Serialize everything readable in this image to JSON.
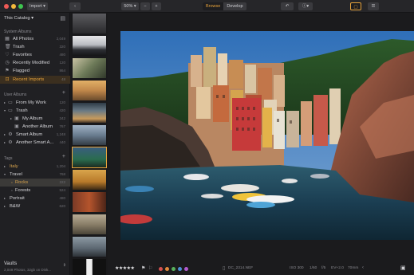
{
  "toolbar": {
    "import_label": "Import ▾",
    "zoom_label": "50% ▾",
    "zoom_out": "−",
    "zoom_in": "+",
    "browse_label": "Browse",
    "develop_label": "Develop",
    "undo_icon": "undo-icon",
    "info_icon": "info-icon"
  },
  "sidebar": {
    "catalog_title": "This Catalog ▾",
    "system_albums_title": "System Albums",
    "system_albums": [
      {
        "label": "All Photos",
        "count": "2,049",
        "icon": "photos-icon"
      },
      {
        "label": "Trash",
        "count": "320",
        "icon": "trash-icon"
      },
      {
        "label": "Favorites",
        "count": "480",
        "icon": "heart-icon"
      },
      {
        "label": "Recently Modified",
        "count": "120",
        "icon": "clock-icon"
      },
      {
        "label": "Flagged",
        "count": "864",
        "icon": "flag-icon"
      },
      {
        "label": "Recent Imports",
        "count": "48",
        "icon": "import-icon"
      }
    ],
    "user_albums_title": "User Albums",
    "user_albums": [
      {
        "label": "From My Work",
        "count": "120"
      },
      {
        "label": "Trash",
        "count": "420"
      },
      {
        "label": "My Album",
        "count": "342"
      },
      {
        "label": "Another Album",
        "count": "767"
      },
      {
        "label": "Smart Album",
        "count": "1,248"
      },
      {
        "label": "Another Smart A...",
        "count": "440"
      }
    ],
    "tags_title": "Tags",
    "tags": [
      {
        "label": "Italy",
        "count": "1,204",
        "color": "#d8a44e"
      },
      {
        "label": "Travel",
        "count": "768"
      },
      {
        "label": "Rocks",
        "count": "222"
      },
      {
        "label": "Forests",
        "count": "524"
      },
      {
        "label": "Portrait",
        "count": "480"
      },
      {
        "label": "B&W",
        "count": "620"
      }
    ],
    "vaults_title": "Vaults",
    "vaults_subtitle": "2,049 Photos, 32gb on Disk..."
  },
  "bottombar": {
    "stars": "★★★★★",
    "filename": "DC_2314.NEF",
    "iso": "ISO 300",
    "shutter": "1/60",
    "aperture": "f/5",
    "ev": "EV+2.0",
    "focal": "70mm",
    "label_colors": [
      "#d6504f",
      "#e08a3c",
      "#58b05c",
      "#4a8fd6",
      "#b45bd0"
    ]
  },
  "colors": {
    "accent": "#e7a33b",
    "selection_bg": "#3b2f1f"
  }
}
